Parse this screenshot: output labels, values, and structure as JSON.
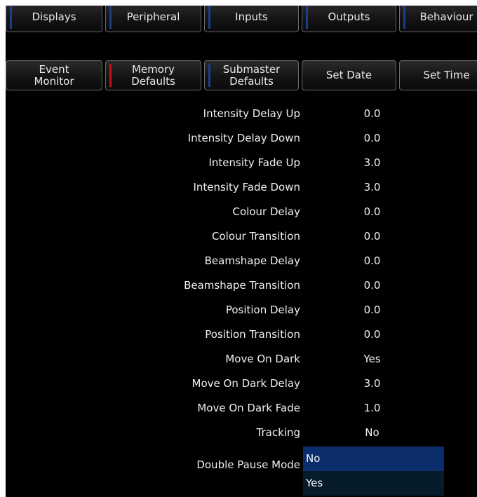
{
  "tabs_row1": [
    {
      "label": "Displays",
      "indicator": "#1c3d8a"
    },
    {
      "label": "Peripheral",
      "indicator": "#1c3d8a"
    },
    {
      "label": "Inputs",
      "indicator": "#1c3d8a"
    },
    {
      "label": "Outputs",
      "indicator": "#1c3d8a"
    },
    {
      "label": "Behaviour",
      "indicator": "#1c3d8a"
    }
  ],
  "tabs_row2": [
    {
      "label": "Event\nMonitor",
      "indicator": ""
    },
    {
      "label": "Memory\nDefaults",
      "indicator": "#c0141a"
    },
    {
      "label": "Submaster\nDefaults",
      "indicator": "#1c3d8a"
    },
    {
      "label": "Set Date",
      "indicator": ""
    },
    {
      "label": "Set Time",
      "indicator": ""
    }
  ],
  "settings": [
    {
      "label": "Intensity Delay Up",
      "value": "0.0"
    },
    {
      "label": "Intensity Delay Down",
      "value": "0.0"
    },
    {
      "label": "Intensity Fade Up",
      "value": "3.0"
    },
    {
      "label": "Intensity Fade Down",
      "value": "3.0"
    },
    {
      "label": "Colour Delay",
      "value": "0.0"
    },
    {
      "label": "Colour Transition",
      "value": "0.0"
    },
    {
      "label": "Beamshape Delay",
      "value": "0.0"
    },
    {
      "label": "Beamshape Transition",
      "value": "0.0"
    },
    {
      "label": "Position Delay",
      "value": "0.0"
    },
    {
      "label": "Position Transition",
      "value": "0.0"
    },
    {
      "label": "Move On Dark",
      "value": "Yes"
    },
    {
      "label": "Move On Dark Delay",
      "value": "3.0"
    },
    {
      "label": "Move On Dark Fade",
      "value": "1.0"
    },
    {
      "label": "Tracking",
      "value": "No"
    }
  ],
  "double_pause": {
    "label": "Double Pause Mode",
    "options": [
      "No",
      "Yes"
    ],
    "selected": "No"
  },
  "colors": {
    "selected_option": "#0c2d6b",
    "unselected_option": "#061c2a",
    "indicator_blue": "#1c3d8a",
    "indicator_red": "#c0141a"
  }
}
